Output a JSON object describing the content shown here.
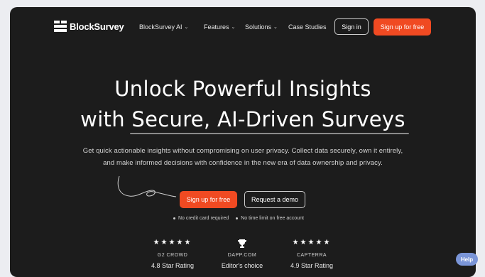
{
  "brand": {
    "name": "BlockSurvey"
  },
  "nav": {
    "items": [
      {
        "label": "BlockSurvey AI ",
        "has_dropdown": true
      },
      {
        "label": "Features",
        "has_dropdown": true
      },
      {
        "label": "Solutions",
        "has_dropdown": true
      },
      {
        "label": "Case Studies",
        "has_dropdown": false
      }
    ],
    "signin_label": "Sign in",
    "signup_label": "Sign up for free"
  },
  "hero": {
    "line1": "Unlock Powerful Insights",
    "line2": "with Secure, AI-Driven Surveys",
    "desc1": "Get quick actionable insights without compromising on user privacy. Collect data securely, own it entirely,",
    "desc2": "and make informed decisions with confidence in the new era of data ownership and privacy.",
    "cta_label": "Sign up for free",
    "demo_label": "Request a demo",
    "note1": "No credit card required",
    "note2": "No time limit on free account"
  },
  "badges": [
    {
      "icon": "stars",
      "stars": "★★★★★",
      "name": "G2 CROWD",
      "rating": "4.8 Star Rating"
    },
    {
      "icon": "trophy-icon",
      "name": "DAPP.COM",
      "rating": "Editor's choice"
    },
    {
      "icon": "stars",
      "stars": "★★★★★",
      "name": "CAPTERRA",
      "rating": "4.9 Star Rating"
    }
  ],
  "help_label": "Help",
  "colors": {
    "accent": "#f04a22",
    "background": "#1c1c1c",
    "help": "#7a95d8"
  }
}
